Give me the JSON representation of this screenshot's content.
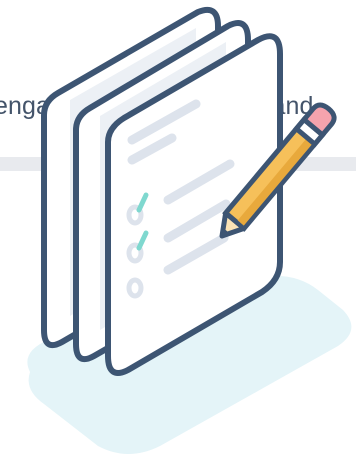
{
  "caption": {
    "text": "engagement with your brand"
  },
  "colors": {
    "page_background": "#ffffff",
    "band": "#e8eaee",
    "shadow": "#e4f4f8",
    "outline": "#3d5573",
    "paper": "#ffffff",
    "rule_lines": "#dde3ec",
    "check_marks": "#7fd8cf",
    "pencil_body": "#f6c05a",
    "pencil_shade": "#e8a93c",
    "pencil_eraser": "#f5a3ad",
    "pencil_wood": "#fbe3b5",
    "text": "#44546a"
  },
  "illustration": {
    "subject": "stacked-checklist-with-pencil",
    "checklist_items": [
      {
        "checked": true
      },
      {
        "checked": true
      },
      {
        "checked": false
      }
    ]
  }
}
